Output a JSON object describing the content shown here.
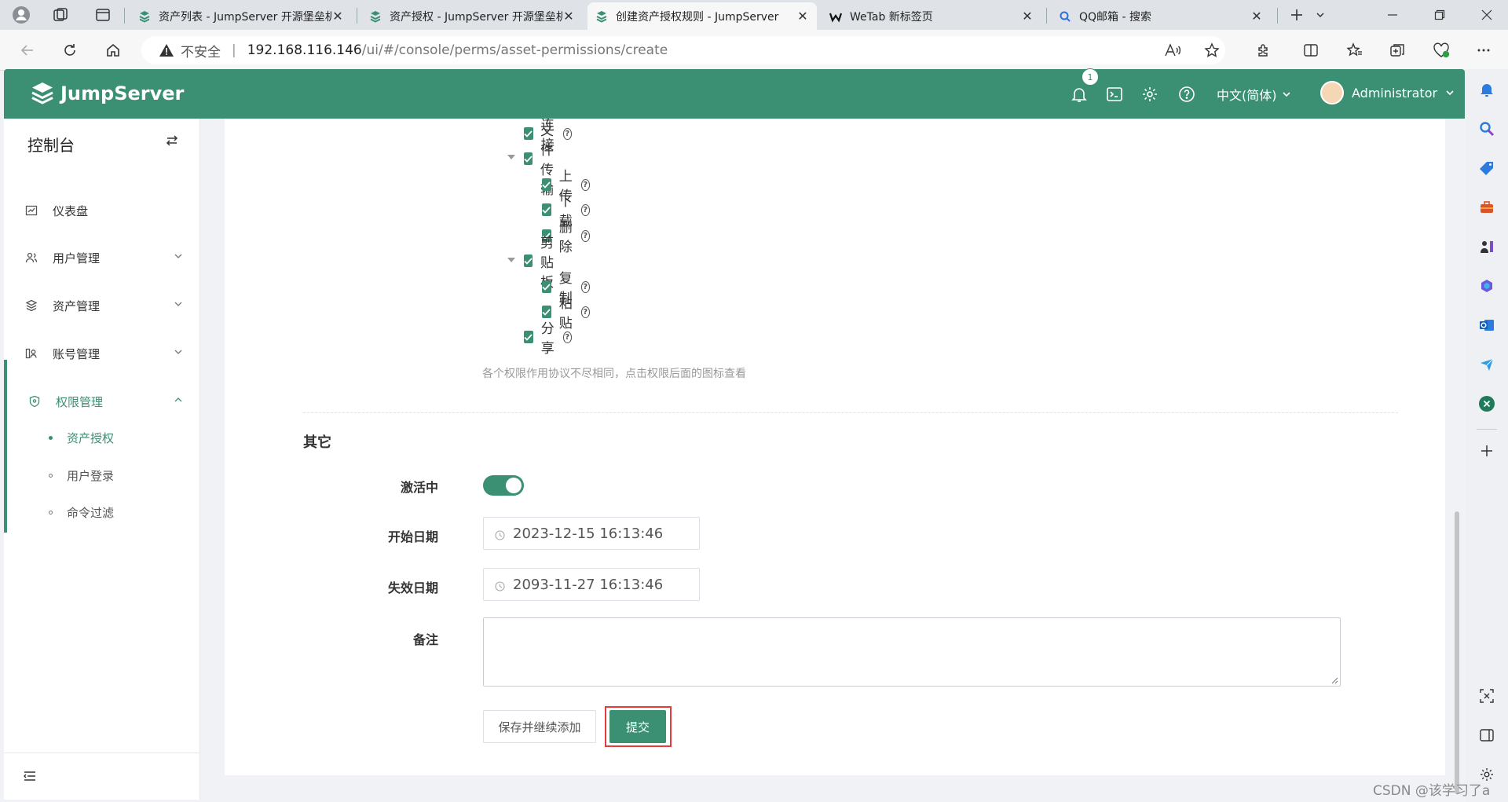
{
  "browser": {
    "tabs": [
      {
        "title": "资产列表 - JumpServer 开源堡垒机",
        "active": false
      },
      {
        "title": "资产授权 - JumpServer 开源堡垒机",
        "active": false
      },
      {
        "title": "创建资产授权规则 - JumpServer",
        "active": true
      },
      {
        "title": "WeTab 新标签页",
        "active": false
      },
      {
        "title": "QQ邮箱 - 搜索",
        "active": false
      }
    ],
    "security": "不安全",
    "url_host": "192.168.116.146",
    "url_path": "/ui/#/console/perms/asset-permissions/create"
  },
  "header": {
    "brand": "JumpServer",
    "notification_count": "1",
    "language": "中文(简体)",
    "user": "Administrator",
    "accent": "#3b8f72"
  },
  "sidebar": {
    "title": "控制台",
    "items": [
      {
        "label": "仪表盘"
      },
      {
        "label": "用户管理"
      },
      {
        "label": "资产管理"
      },
      {
        "label": "账号管理"
      },
      {
        "label": "权限管理"
      }
    ],
    "subitems": [
      {
        "label": "资产授权"
      },
      {
        "label": "用户登录"
      },
      {
        "label": "命令过滤"
      }
    ]
  },
  "form": {
    "actions_tree": [
      {
        "label": "连接",
        "checked": true
      },
      {
        "label": "文件传输",
        "checked": true
      },
      {
        "label": "上传",
        "checked": true
      },
      {
        "label": "下载",
        "checked": true
      },
      {
        "label": "删除",
        "checked": true
      },
      {
        "label": "剪贴板",
        "checked": true
      },
      {
        "label": "复制",
        "checked": true
      },
      {
        "label": "粘贴",
        "checked": true
      },
      {
        "label": "分享",
        "checked": true
      }
    ],
    "actions_hint": "各个权限作用协议不尽相同，点击权限后面的图标查看",
    "section_other": "其它",
    "active_label": "激活中",
    "active_value": true,
    "start_label": "开始日期",
    "start_value": "2023-12-15 16:13:46",
    "end_label": "失效日期",
    "end_value": "2093-11-27 16:13:46",
    "comment_label": "备注",
    "comment_value": "",
    "save_continue_label": "保存并继续添加",
    "submit_label": "提交"
  },
  "watermark": "CSDN @该学习了a"
}
